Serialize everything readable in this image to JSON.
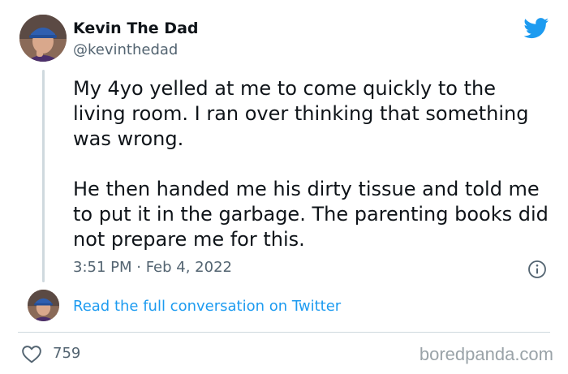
{
  "tweet": {
    "author": {
      "display_name": "Kevin The Dad",
      "handle": "@kevinthedad"
    },
    "text_paragraphs": [
      "My 4yo yelled at me to come quickly to the living room. I ran over thinking that something was wrong.",
      "He then handed me his dirty tissue and told me to put it in the garbage. The parenting books did not prepare me for this."
    ],
    "timestamp": "3:51 PM · Feb 4, 2022",
    "read_conversation_link": "Read the full conversation on Twitter",
    "likes": "759"
  },
  "watermark": "boredpanda.com",
  "icons": {
    "brand": "twitter-bird-icon",
    "info": "info-icon",
    "like": "heart-icon"
  },
  "colors": {
    "twitter_blue": "#1d9bf0",
    "text_primary": "#0f1419",
    "text_secondary": "#536471",
    "divider": "#cfd9de"
  }
}
